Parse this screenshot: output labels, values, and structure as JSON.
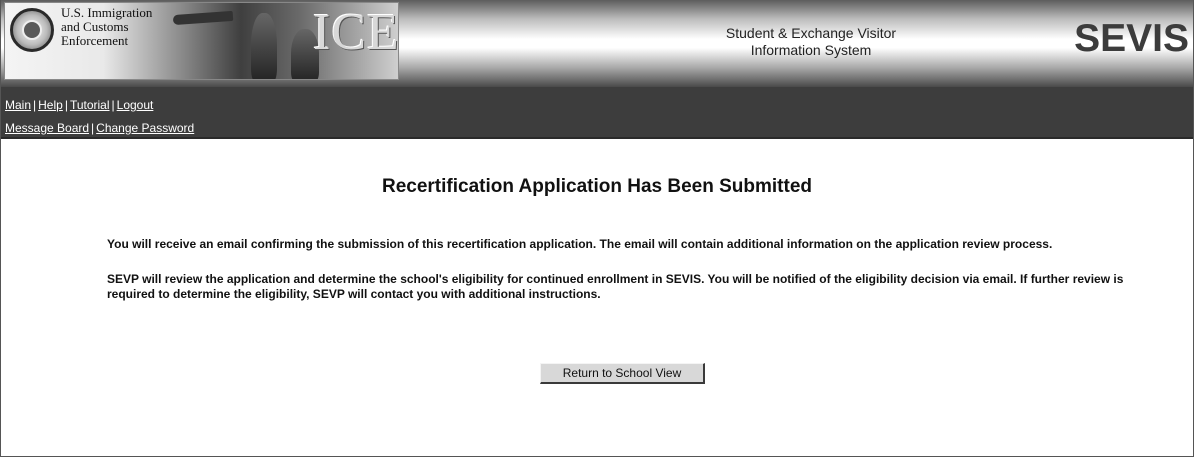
{
  "header": {
    "agency_lines": [
      "U.S. Immigration",
      "and Customs",
      "Enforcement"
    ],
    "agency_logo_text": "ICE",
    "system_name_lines": [
      "Student & Exchange Visitor",
      "Information System"
    ],
    "system_logo_text": "SEVIS"
  },
  "nav": {
    "row1": [
      {
        "label": "Main"
      },
      {
        "label": "Help"
      },
      {
        "label": "Tutorial"
      },
      {
        "label": "Logout"
      }
    ],
    "row2": [
      {
        "label": "Message Board"
      },
      {
        "label": "Change Password"
      }
    ],
    "separator": "|"
  },
  "main": {
    "title": "Recertification Application Has Been Submitted",
    "message_1": "You will receive an email confirming the submission of this recertification application. The email will contain additional information on the application review process.",
    "message_2": "SEVP will review the application and determine the school's eligibility for continued enrollment in SEVIS. You will be notified of the eligibility decision via email. If further review is required to determine the eligibility, SEVP will contact you with additional instructions.",
    "return_button_label": "Return to School View"
  },
  "colors": {
    "nav_background": "#3d3d3d",
    "nav_text": "#ffffff",
    "button_face": "#d8d8d8"
  },
  "icons": {
    "seal": "dhs-seal-icon"
  }
}
